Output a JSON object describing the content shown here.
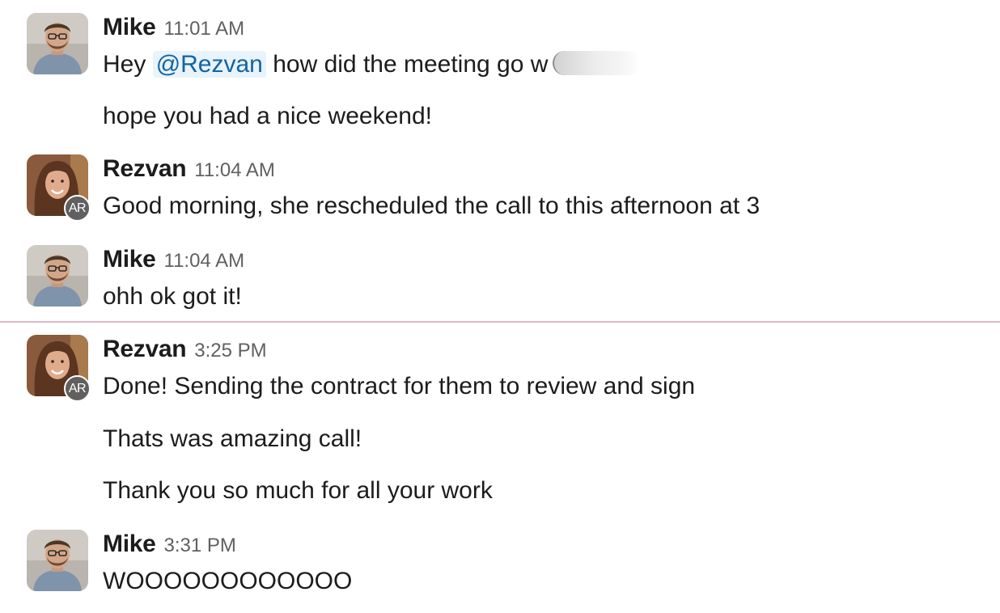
{
  "messages": [
    {
      "author": "Mike",
      "time": "11:01 AM",
      "lines": {
        "l0_pre": "Hey ",
        "l0_mention": "@Rezvan",
        "l0_post": " how did the meeting go w",
        "l1": "hope you had a nice weekend!"
      }
    },
    {
      "author": "Rezvan",
      "badge": "AR",
      "time": "11:04 AM",
      "lines": {
        "l0": "Good morning, she rescheduled the call to this afternoon at 3"
      }
    },
    {
      "author": "Mike",
      "time": "11:04 AM",
      "lines": {
        "l0": "ohh ok got it!"
      }
    },
    {
      "author": "Rezvan",
      "badge": "AR",
      "time": "3:25 PM",
      "lines": {
        "l0": "Done! Sending the contract for them to review and sign",
        "l1": "Thats was amazing call!",
        "l2": "Thank you so much for all your work"
      }
    },
    {
      "author": "Mike",
      "time": "3:31 PM",
      "lines": {
        "l0": "WOOOOOOOOOOOO"
      }
    }
  ],
  "colors": {
    "mention_bg": "#e8f3fb",
    "mention_text": "#1264a3",
    "new_divider": "#e3b6c6",
    "badge_bg": "#616061"
  }
}
